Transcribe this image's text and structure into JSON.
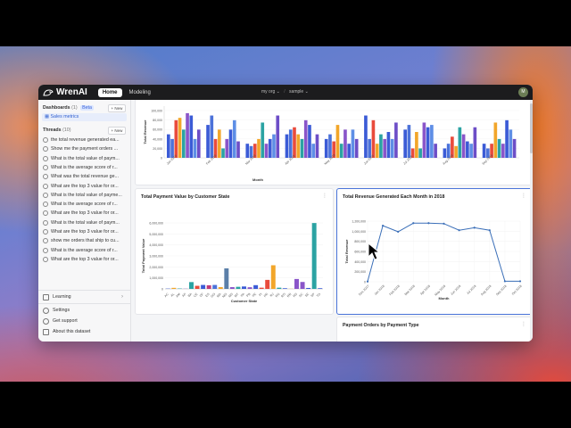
{
  "app": {
    "name": "WrenAI"
  },
  "topbar": {
    "home_label": "Home",
    "modeling_label": "Modeling",
    "org_label": "my org",
    "project_label": "sample",
    "avatar_initials": "M"
  },
  "sidebar": {
    "dashboards_label": "Dashboards",
    "dashboards_count": "(1)",
    "beta_label": "Beta",
    "new_label": "+ New",
    "dashboard_items": [
      "Sales metrics"
    ],
    "threads_label": "Threads",
    "threads_count": "(10)",
    "threads": [
      "the total revenue generated ea...",
      "Show me the payment orders ...",
      "What is the total value of paym...",
      "What is the average score of r...",
      "What was the total revenue ge...",
      "What are the top 3 value for or...",
      "What is the total value of payme...",
      "What is the average score of r...",
      "What are the top 3 value for or...",
      "What is the total value of paym...",
      "What are the top 3 value for or...",
      "show me orders that ship to cu...",
      "What is the average score of r...",
      "What are the top 3 value for or..."
    ],
    "learning_label": "Learning",
    "settings_label": "Settings",
    "support_label": "Get support",
    "about_label": "About this dataset"
  },
  "colors": {
    "accent": "#4a74d9",
    "topbar_bg": "#1c1c1e",
    "selected_bg": "#e7edfb"
  },
  "main": {
    "top_chart": {
      "title": "",
      "chart_data": {
        "type": "bar",
        "ylabel": "Total Revenue",
        "xlabel": "Month",
        "ytick_labels": [
          "100,000",
          "80,000",
          "60,000",
          "40,000",
          "20,000",
          "0"
        ],
        "xtick_labels": [
          "Jan 2018",
          "Feb 2018",
          "Mar 2018",
          "Apr 2018",
          "May 2018",
          "Jun 2018",
          "Jul 2018",
          "Aug 2018",
          "Sep 2018"
        ],
        "ylim": [
          0,
          110000
        ],
        "category_count": 9,
        "series_colors": [
          "#3b5bd6",
          "#4c72d9",
          "#e94b3c",
          "#f2a62a",
          "#2ba3a3",
          "#8a55c9",
          "#3b5bd6",
          "#5e8ee6",
          "#6d4ec7"
        ],
        "values": [
          [
            50000,
            70000,
            30000,
            50000,
            40000,
            90000,
            60000,
            20000,
            30000
          ],
          [
            40000,
            90000,
            25000,
            60000,
            50000,
            40000,
            70000,
            30000,
            20000
          ],
          [
            80000,
            40000,
            30000,
            65000,
            35000,
            80000,
            20000,
            45000,
            30000
          ],
          [
            85000,
            60000,
            40000,
            50000,
            70000,
            30000,
            55000,
            25000,
            75000
          ],
          [
            60000,
            20000,
            75000,
            40000,
            30000,
            50000,
            20000,
            65000,
            40000
          ],
          [
            95000,
            40000,
            30000,
            80000,
            60000,
            40000,
            75000,
            50000,
            30000
          ],
          [
            90000,
            60000,
            40000,
            70000,
            30000,
            55000,
            65000,
            35000,
            80000
          ],
          [
            40000,
            80000,
            50000,
            30000,
            60000,
            40000,
            70000,
            30000,
            60000
          ],
          [
            60000,
            35000,
            90000,
            50000,
            40000,
            75000,
            30000,
            65000,
            40000
          ]
        ]
      }
    },
    "state_chart": {
      "title": "Total Payment Value by Customer State",
      "chart_data": {
        "type": "bar",
        "xlabel": "Customer State",
        "ylabel": "Total Payment Value",
        "ylim": [
          0,
          6000000
        ],
        "ytick_labels": [
          "6,000,000",
          "5,000,000",
          "4,000,000",
          "3,000,000",
          "2,000,000",
          "1,000,000",
          "0"
        ],
        "categories": [
          "AC",
          "AL",
          "AM",
          "AP",
          "BA",
          "CE",
          "DF",
          "ES",
          "GO",
          "MA",
          "MG",
          "MS",
          "MT",
          "PA",
          "PB",
          "PE",
          "PI",
          "PR",
          "RJ",
          "RN",
          "RO",
          "RR",
          "RS",
          "SC",
          "SE",
          "SP",
          "TO"
        ],
        "values": [
          25000,
          95000,
          35000,
          16000,
          620000,
          280000,
          360000,
          330000,
          360000,
          160000,
          1870000,
          160000,
          190000,
          220000,
          150000,
          340000,
          110000,
          820000,
          2150000,
          110000,
          60000,
          10000,
          900000,
          630000,
          85000,
          5990000,
          62000
        ],
        "colors": [
          "#3b5bd6",
          "#f2a62a",
          "#2ba3a3",
          "#8a55c9",
          "#2ba3a3",
          "#e94b3c",
          "#3b5bd6",
          "#c03b7a",
          "#4c72d9",
          "#f2a62a",
          "#5b7fa8",
          "#8a55c9",
          "#2ba3a3",
          "#3b5bd6",
          "#8a55c9",
          "#3b5bd6",
          "#e94b3c",
          "#e94b3c",
          "#f2a62a",
          "#2ba3a3",
          "#3b5bd6",
          "#f2a62a",
          "#8a55c9",
          "#8a55c9",
          "#3b5bd6",
          "#2ba3a3",
          "#3b5bd6"
        ]
      }
    },
    "monthly_chart": {
      "title": "Total Revenue Generated Each Month in 2018",
      "chart_data": {
        "type": "line",
        "xlabel": "Month",
        "ylabel": "Total Revenue",
        "ylim": [
          0,
          1200000
        ],
        "ytick_labels": [
          "1,200,000",
          "1,000,000",
          "800,000",
          "600,000",
          "400,000",
          "200,000",
          "0"
        ],
        "categories": [
          "Dec 2017",
          "Jan 2018",
          "Feb 2018",
          "Mar 2018",
          "Apr 2018",
          "May 2018",
          "Jun 2018",
          "Jul 2018",
          "Aug 2018",
          "Sep 2018",
          "Oct 2018"
        ],
        "values": [
          5000,
          1110000,
          990000,
          1160000,
          1160000,
          1150000,
          1020000,
          1070000,
          1020000,
          10000,
          10000
        ],
        "color": "#3b6fb8"
      }
    },
    "payment_card": {
      "title": "Payment Orders by Payment Type"
    }
  }
}
